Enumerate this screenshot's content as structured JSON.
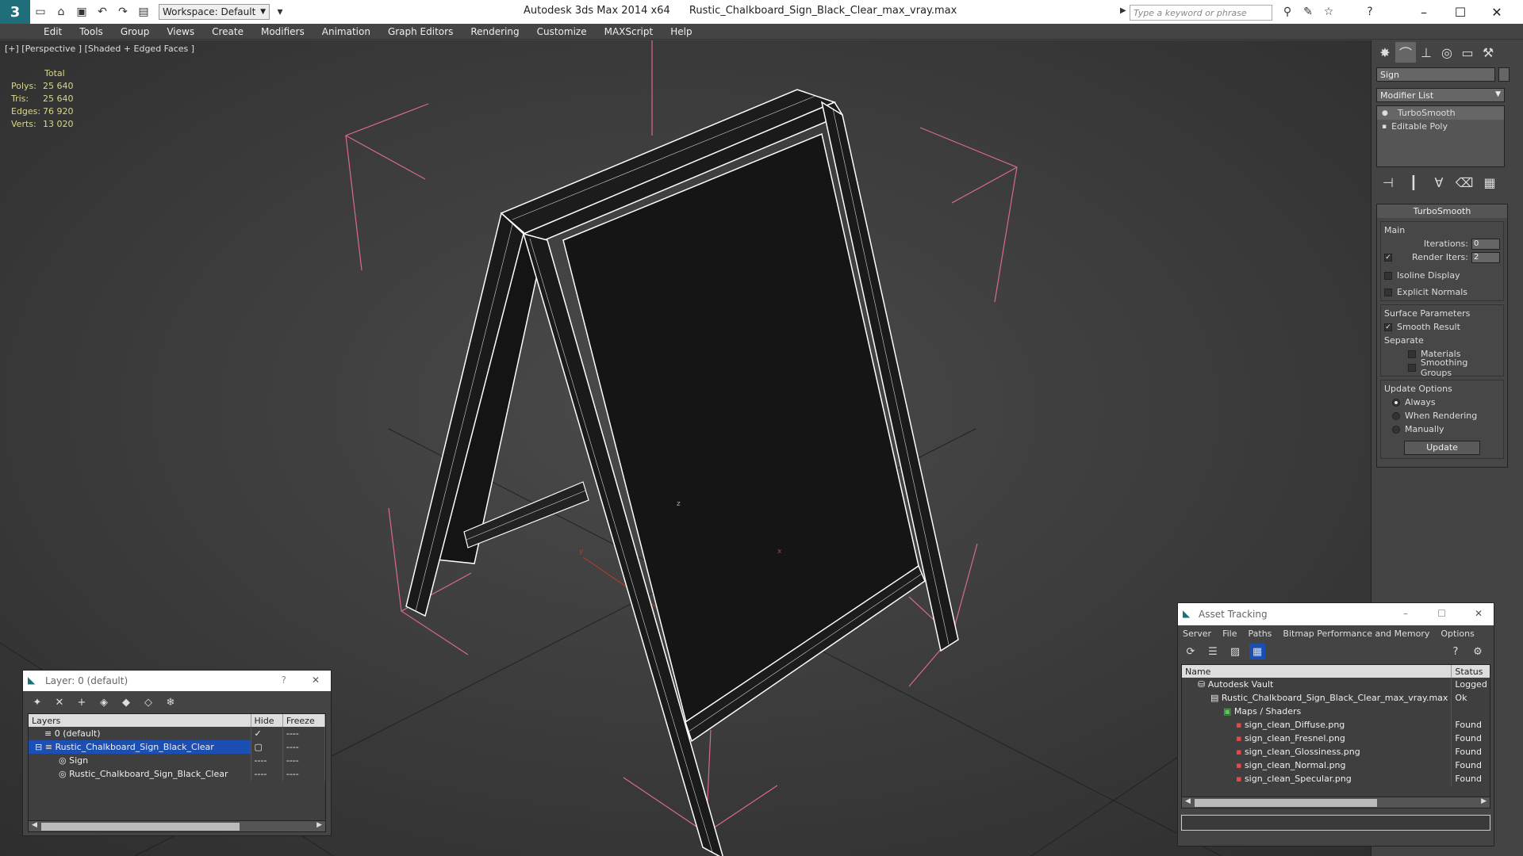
{
  "app": {
    "title": "Autodesk 3ds Max  2014 x64",
    "filename": "Rustic_Chalkboard_Sign_Black_Clear_max_vray.max",
    "logo_glyph": "3",
    "workspace_label": "Workspace: Default",
    "search_placeholder": "Type a keyword or phrase"
  },
  "menu": [
    "Edit",
    "Tools",
    "Group",
    "Views",
    "Create",
    "Modifiers",
    "Animation",
    "Graph Editors",
    "Rendering",
    "Customize",
    "MAXScript",
    "Help"
  ],
  "viewport": {
    "label": "[+] [Perspective ] [Shaded + Edged Faces ]",
    "stats": {
      "header": "Total",
      "rows": [
        {
          "label": "Polys:",
          "value": "25 640"
        },
        {
          "label": "Tris:",
          "value": "25 640"
        },
        {
          "label": "Edges:",
          "value": "76 920"
        },
        {
          "label": "Verts:",
          "value": "13 020"
        }
      ]
    },
    "axis": {
      "z": "z",
      "x": "x",
      "y": "y"
    }
  },
  "command_panel": {
    "object_name": "Sign",
    "modifier_list": "Modifier List",
    "stack": [
      "TurboSmooth",
      "Editable Poly"
    ],
    "rollout_title": "TurboSmooth",
    "main_label": "Main",
    "iterations_label": "Iterations:",
    "iterations_value": "0",
    "render_iters_label": "Render Iters:",
    "render_iters_value": "2",
    "isoline": "Isoline Display",
    "explicit_normals": "Explicit Normals",
    "surface_params": "Surface Parameters",
    "smooth_result": "Smooth Result",
    "separate": "Separate",
    "materials": "Materials",
    "smoothing_groups": "Smoothing Groups",
    "update_options": "Update Options",
    "always": "Always",
    "when_rendering": "When Rendering",
    "manually": "Manually",
    "update_button": "Update"
  },
  "layer_window": {
    "title": "Layer: 0 (default)",
    "help": "?",
    "close": "✕",
    "columns": [
      "Layers",
      "Hide",
      "Freeze"
    ],
    "rows": [
      {
        "name": "0 (default)",
        "indent": 1,
        "selected": false
      },
      {
        "name": "Rustic_Chalkboard_Sign_Black_Clear",
        "indent": 1,
        "selected": true
      },
      {
        "name": "Sign",
        "indent": 2,
        "selected": false
      },
      {
        "name": "Rustic_Chalkboard_Sign_Black_Clear",
        "indent": 2,
        "selected": false
      }
    ],
    "dash": "----"
  },
  "asset_window": {
    "title": "Asset Tracking",
    "menu": [
      "Server",
      "File",
      "Paths",
      "Bitmap Performance and Memory",
      "Options"
    ],
    "columns": [
      "Name",
      "Status"
    ],
    "rows": [
      {
        "name": "Autodesk Vault",
        "status": "Logged Ou",
        "indent": 1
      },
      {
        "name": "Rustic_Chalkboard_Sign_Black_Clear_max_vray.max",
        "status": "Ok",
        "indent": 2
      },
      {
        "name": "Maps / Shaders",
        "status": "",
        "indent": 3
      },
      {
        "name": "sign_clean_Diffuse.png",
        "status": "Found",
        "indent": 4
      },
      {
        "name": "sign_clean_Fresnel.png",
        "status": "Found",
        "indent": 4
      },
      {
        "name": "sign_clean_Glossiness.png",
        "status": "Found",
        "indent": 4
      },
      {
        "name": "sign_clean_Normal.png",
        "status": "Found",
        "indent": 4
      },
      {
        "name": "sign_clean_Specular.png",
        "status": "Found",
        "indent": 4
      }
    ]
  },
  "colors": {
    "selection": "#1b4fb3",
    "stats_text": "#d8d88a",
    "light_gizmo": "#d96a8a"
  }
}
